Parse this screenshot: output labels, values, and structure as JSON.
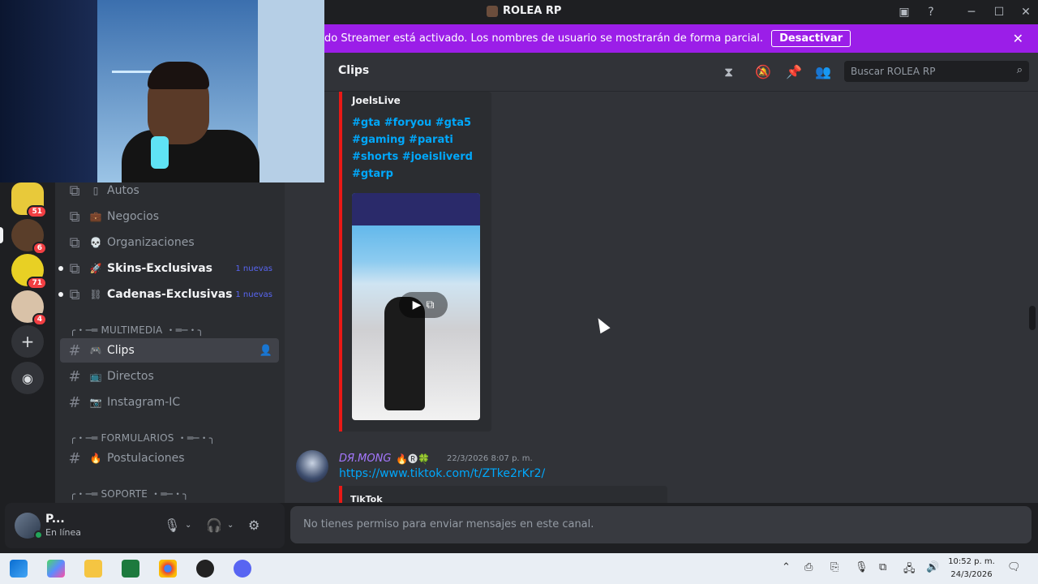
{
  "window": {
    "title": "ROLEA RP"
  },
  "banner": {
    "text": "do Streamer está activado. Los nombres de usuario se mostrarán de forma parcial.",
    "button": "Desactivar"
  },
  "servers": [
    {
      "badge": "51"
    },
    {
      "badge": "6"
    },
    {
      "badge": "71"
    },
    {
      "badge": "4"
    }
  ],
  "channels": {
    "items": [
      {
        "emoji": "▯",
        "label": "Autos"
      },
      {
        "emoji": "💼",
        "label": "Negocios"
      },
      {
        "emoji": "💀",
        "label": "Organizaciones"
      },
      {
        "emoji": "🚀",
        "label": "Skins-Exclusivas",
        "tag": "1 nuevas"
      },
      {
        "emoji": "⛓",
        "label": "Cadenas-Exclusivas",
        "tag": "1 nuevas"
      }
    ],
    "cat_multimedia": "╭・─═ MULTIMEDIA ・═─・╮",
    "multimedia": [
      {
        "emoji": "🎮",
        "label": "Clips"
      },
      {
        "emoji": "📺",
        "label": "Directos"
      },
      {
        "emoji": "📷",
        "label": "Instagram-IC"
      }
    ],
    "cat_formularios": "╭・─═ FORMULARIOS ・═─・╮",
    "formularios": [
      {
        "emoji": "🔥",
        "label": "Postulaciones"
      }
    ],
    "cat_soporte": "╭・─═ SOPORTE ・═─・╮"
  },
  "user": {
    "name": "P...",
    "status": "En línea"
  },
  "header": {
    "channel": "Clips",
    "search_placeholder": "Buscar ROLEA RP"
  },
  "embed1": {
    "author": "JoelsLive",
    "tags": "#gta #foryou #gta5 #gaming #parati #shorts #joeisliverd #gtarp"
  },
  "message": {
    "username": "DЯ.ΜΟΝG",
    "time": "22/3/2026 8:07 p. m.",
    "link": "https://www.tiktok.com/t/ZTke2rKr2/",
    "provider": "TikTok"
  },
  "composer": {
    "noperm": "No tienes permiso para enviar mensajes en este canal."
  },
  "clock": {
    "time": "10:52 p. m.",
    "date": "24/3/2026"
  },
  "colors": {
    "banner": "#9b1ee8",
    "accent_link": "#00a8fc",
    "embed_border": "#e91916",
    "online": "#23a55a"
  }
}
